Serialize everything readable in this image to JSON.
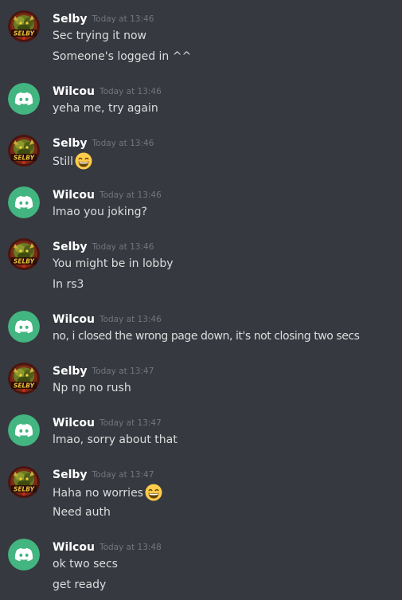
{
  "messages": [
    {
      "author": "Selby",
      "time": "Today at 13:46",
      "avatar": "selby-avatar",
      "lines": [
        "Sec trying it now",
        "Someone's logged in ^^"
      ]
    },
    {
      "author": "Wilcou",
      "time": "Today at 13:46",
      "avatar": "discord-default-avatar",
      "lines": [
        "yeha me, try again"
      ]
    },
    {
      "author": "Selby",
      "time": "Today at 13:46",
      "avatar": "selby-avatar",
      "lines": [
        "Still"
      ],
      "emoji": "grinning-face-emoji"
    },
    {
      "author": "Wilcou",
      "time": "Today at 13:46",
      "avatar": "discord-default-avatar",
      "lines": [
        "lmao you joking?"
      ]
    },
    {
      "author": "Selby",
      "time": "Today at 13:46",
      "avatar": "selby-avatar",
      "lines": [
        "You might be in lobby",
        "In rs3"
      ]
    },
    {
      "author": "Wilcou",
      "time": "Today at 13:46",
      "avatar": "discord-default-avatar",
      "lines": [
        "no, i closed the wrong page down, it's not closing two secs"
      ]
    },
    {
      "author": "Selby",
      "time": "Today at 13:47",
      "avatar": "selby-avatar",
      "lines": [
        "Np np no rush"
      ]
    },
    {
      "author": "Wilcou",
      "time": "Today at 13:47",
      "avatar": "discord-default-avatar",
      "lines": [
        "lmao, sorry about that"
      ]
    },
    {
      "author": "Selby",
      "time": "Today at 13:47",
      "avatar": "selby-avatar",
      "lines": [
        "Haha no worries",
        "Need auth"
      ],
      "emoji": "grinning-face-emoji"
    },
    {
      "author": "Wilcou",
      "time": "Today at 13:48",
      "avatar": "discord-default-avatar",
      "lines": [
        "ok two secs",
        "get ready"
      ]
    }
  ],
  "colors": {
    "background": "#36393f",
    "username": "#ffffff",
    "timestamp": "#72767d",
    "text": "#dcddde",
    "discord_blurple_bg": "#43b581"
  }
}
